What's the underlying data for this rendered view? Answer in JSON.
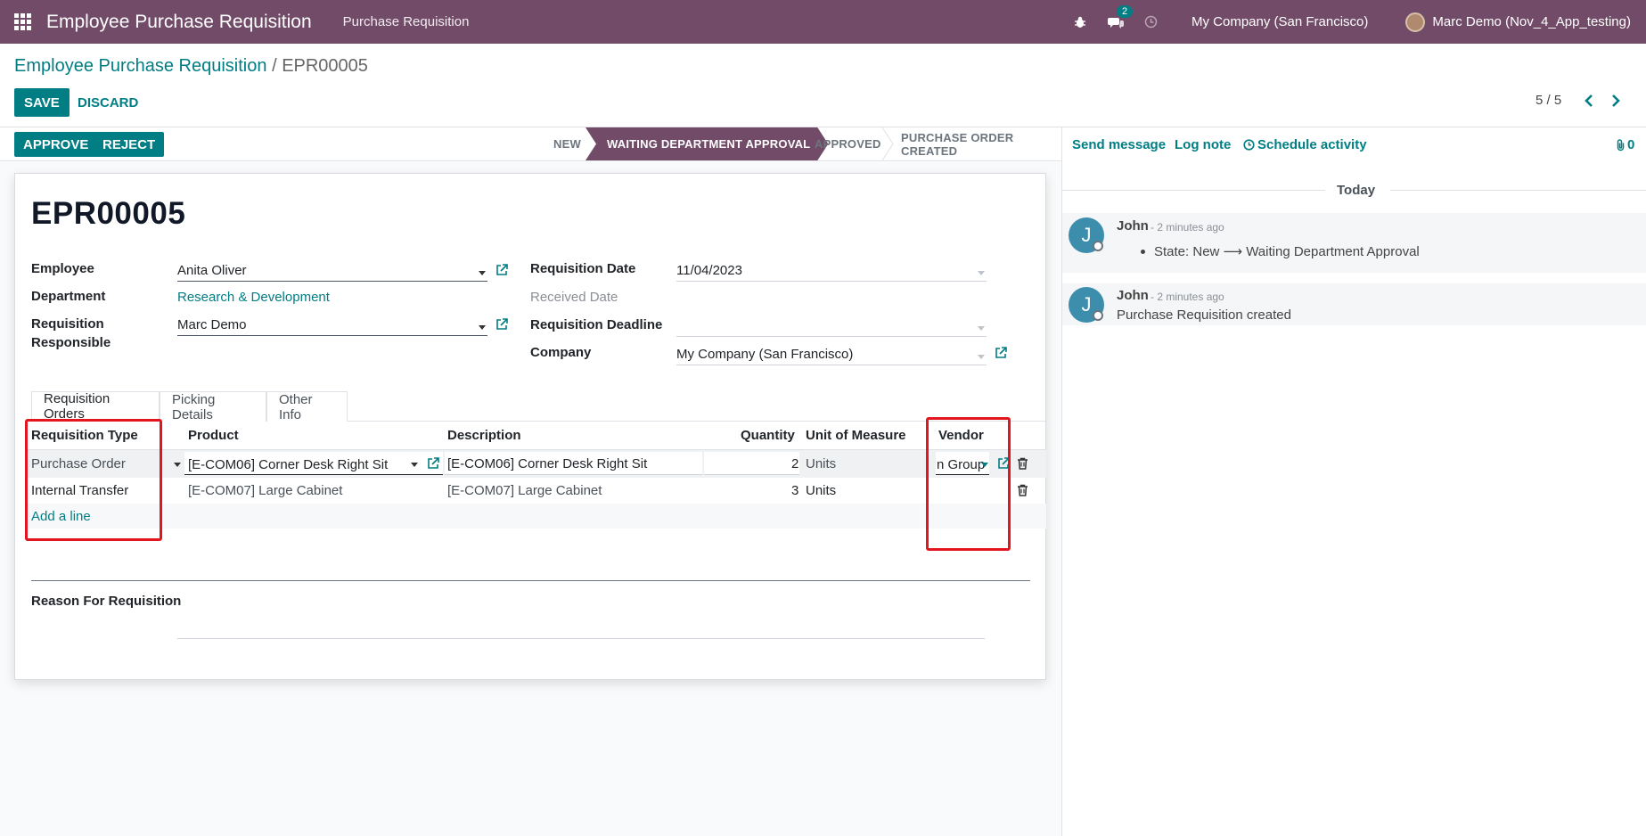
{
  "navbar": {
    "app_title": "Employee Purchase Requisition",
    "menu_item": "Purchase Requisition",
    "message_count": "2",
    "company": "My Company (San Francisco)",
    "user": "Marc Demo (Nov_4_App_testing)"
  },
  "breadcrumb": {
    "parent": "Employee Purchase Requisition",
    "separator": "/",
    "current": "EPR00005"
  },
  "actions": {
    "save": "SAVE",
    "discard": "DISCARD"
  },
  "pager": {
    "value": "5 / 5"
  },
  "header_buttons": {
    "approve": "APPROVE",
    "reject": "REJECT"
  },
  "status": {
    "stages": [
      "NEW",
      "WAITING DEPARTMENT APPROVAL",
      "APPROVED",
      "PURCHASE ORDER CREATED"
    ],
    "active": "WAITING DEPARTMENT APPROVAL"
  },
  "form": {
    "title": "EPR00005",
    "left": {
      "employee_label": "Employee",
      "employee_value": "Anita Oliver",
      "department_label": "Department",
      "department_value": "Research & Development",
      "responsible_label_1": "Requisition",
      "responsible_label_2": "Responsible",
      "responsible_value": "Marc Demo"
    },
    "right": {
      "req_date_label": "Requisition Date",
      "req_date_value": "11/04/2023",
      "received_label": "Received Date",
      "deadline_label": "Requisition Deadline",
      "company_label": "Company",
      "company_value": "My Company (San Francisco)"
    },
    "tabs": [
      "Requisition Orders",
      "Picking Details",
      "Other Info"
    ],
    "table": {
      "headers": [
        "Requisition Type",
        "Product",
        "Description",
        "Quantity",
        "Unit of Measure",
        "Vendor"
      ],
      "rows": [
        {
          "type": "Purchase Order",
          "product": "[E-COM06] Corner Desk Right Sit",
          "description": "[E-COM06] Corner Desk Right Sit",
          "quantity": "2",
          "uom": "Units",
          "vendor": "n Group"
        },
        {
          "type": "Internal Transfer",
          "product": "[E-COM07] Large Cabinet",
          "description": "[E-COM07] Large Cabinet",
          "quantity": "3",
          "uom": "Units",
          "vendor": ""
        }
      ],
      "add_line": "Add a line"
    },
    "reason_label": "Reason For Requisition"
  },
  "chatter": {
    "send_message": "Send message",
    "log_note": "Log note",
    "schedule_activity": "Schedule activity",
    "attachments": "0",
    "today": "Today",
    "messages": [
      {
        "initial": "J",
        "author": "John",
        "time": "- 2 minutes ago",
        "body": "State: New ⟶ Waiting Department Approval"
      },
      {
        "initial": "J",
        "author": "John",
        "time": "- 2 minutes ago",
        "body": "Purchase Requisition created"
      }
    ]
  },
  "colors": {
    "brand": "#714B67",
    "accent": "#017e84",
    "highlight": "#e3151f"
  }
}
